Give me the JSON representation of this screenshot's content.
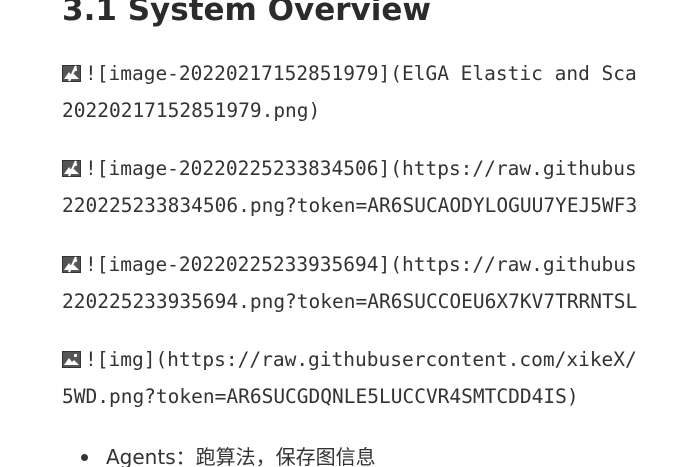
{
  "section": {
    "title": "3.1 System Overview"
  },
  "paragraphs": [
    {
      "icon": "broken-image-icon",
      "lines": [
        "![image-20220217152851979](ElGA Elastic and Sca",
        "20220217152851979.png)"
      ]
    },
    {
      "icon": "broken-image-icon",
      "lines": [
        "![image-20220225233834506](https://raw.githubus",
        "220225233834506.png?token=AR6SUCAODYLOGUU7YEJ5WF3"
      ]
    },
    {
      "icon": "broken-image-icon",
      "lines": [
        "![image-20220225233935694](https://raw.githubus",
        "220225233935694.png?token=AR6SUCCOEU6X7KV7TRRNTSL"
      ]
    },
    {
      "icon": "image-icon",
      "lines": [
        "![img](https://raw.githubusercontent.com/xikeX/",
        "5WD.png?token=AR6SUCGDQNLE5LUCCVR4SMTCDD4IS)"
      ]
    }
  ],
  "bullets": [
    {
      "text": "Agents：跑算法，保存图信息"
    }
  ]
}
